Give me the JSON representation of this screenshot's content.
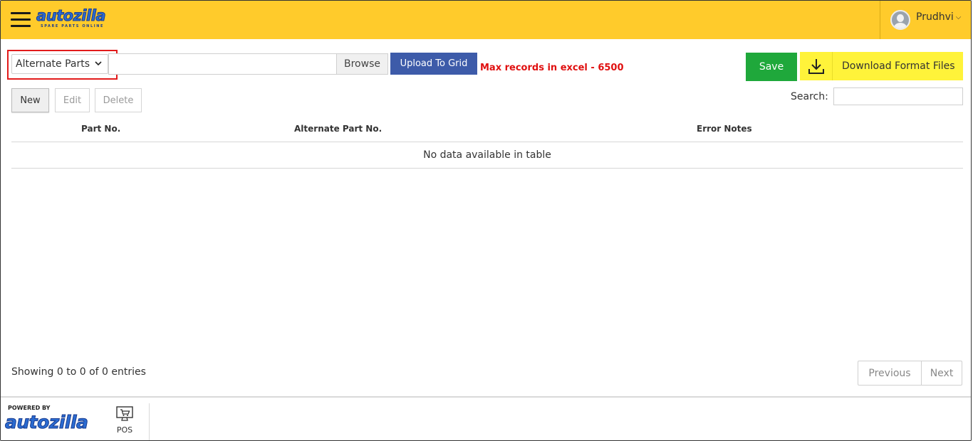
{
  "header": {
    "logo_text": "autozilla",
    "logo_tagline": "SPARE PARTS ONLINE",
    "user_name": "Prudhvi",
    "colors": {
      "bar": "#ffcb2b",
      "logo": "#2a6bd1"
    }
  },
  "toolbar": {
    "type_select_value": "Alternate Parts",
    "browse_label": "Browse",
    "upload_label": "Upload To Grid",
    "max_note": "Max records in excel - 6500",
    "save_label": "Save",
    "download_label": "Download Format Files",
    "colors": {
      "upload": "#3d5ba9",
      "save": "#1fa83b",
      "download": "#fff33a",
      "note": "#e01010",
      "highlight": "#e21b1b"
    }
  },
  "actions": {
    "new_label": "New",
    "edit_label": "Edit",
    "delete_label": "Delete",
    "search_label": "Search:",
    "search_value": ""
  },
  "table": {
    "columns": [
      "Part No.",
      "Alternate Part No.",
      "Error Notes"
    ],
    "empty_message": "No data available in table"
  },
  "footer": {
    "showing_text": "Showing 0 to 0 of 0 entries",
    "previous_label": "Previous",
    "next_label": "Next"
  },
  "bottom_bar": {
    "powered_by": "POWERED BY",
    "logo_text": "autozilla",
    "pos_label": "POS"
  }
}
